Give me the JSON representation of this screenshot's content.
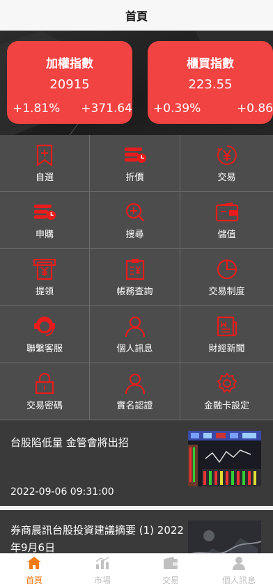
{
  "header": {
    "title": "首頁"
  },
  "indices": [
    {
      "name": "加權指數",
      "value": "20915",
      "pct": "+1.81%",
      "change": "+371.64"
    },
    {
      "name": "櫃買指數",
      "value": "223.55",
      "pct": "+0.39%",
      "change": "+0.86"
    }
  ],
  "menu": [
    {
      "label": "自選",
      "icon": "bookmark-icon"
    },
    {
      "label": "折價",
      "icon": "discount-icon"
    },
    {
      "label": "交易",
      "icon": "yen-exchange-icon"
    },
    {
      "label": "申購",
      "icon": "subscribe-icon"
    },
    {
      "label": "搜尋",
      "icon": "search-icon"
    },
    {
      "label": "儲值",
      "icon": "wallet-icon"
    },
    {
      "label": "提領",
      "icon": "withdraw-icon"
    },
    {
      "label": "帳務查詢",
      "icon": "ledger-icon"
    },
    {
      "label": "交易制度",
      "icon": "pie-chart-icon"
    },
    {
      "label": "聯繫客服",
      "icon": "customer-service-icon"
    },
    {
      "label": "個人訊息",
      "icon": "person-icon"
    },
    {
      "label": "財經新聞",
      "icon": "newspaper-icon"
    },
    {
      "label": "交易密碼",
      "icon": "lock-icon"
    },
    {
      "label": "實名認證",
      "icon": "verify-person-icon"
    },
    {
      "label": "金融卡設定",
      "icon": "settings-icon"
    }
  ],
  "news": [
    {
      "title": "台股陷低量 金管會將出招",
      "time": "2022-09-06 09:31:00"
    },
    {
      "title": "券商晨訊台股投資建議摘要 (1) 2022年9月6日",
      "time": ""
    }
  ],
  "tabbar": [
    {
      "label": "首頁",
      "icon": "home-icon",
      "active": true
    },
    {
      "label": "市場",
      "icon": "market-chart-icon",
      "active": false
    },
    {
      "label": "交易",
      "icon": "wallet-tab-icon",
      "active": false
    },
    {
      "label": "個人訊息",
      "icon": "user-icon",
      "active": false
    }
  ],
  "colors": {
    "accent": "#f24343",
    "icon_red": "#e81c1c",
    "tab_active": "#f07a13",
    "tab_inactive": "#c0c0c0"
  }
}
